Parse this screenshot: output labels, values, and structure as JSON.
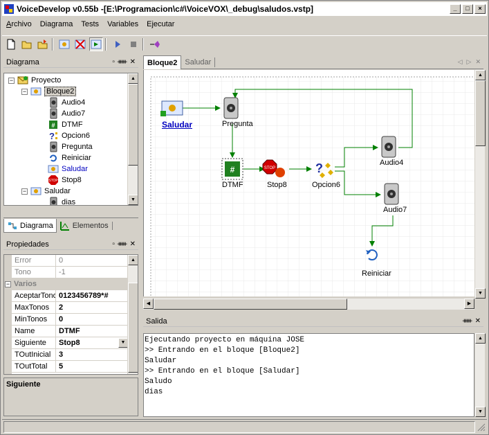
{
  "window": {
    "title": "VoiceDevelop v0.55b  -[E:\\Programacion\\c#\\VoiceVOX\\_debug\\saludos.vstp]",
    "controls": [
      "_",
      "□",
      "×"
    ]
  },
  "menu": [
    {
      "u": "A",
      "rest": "rchivo"
    },
    {
      "u": "",
      "rest": "Diagrama"
    },
    {
      "u": "",
      "rest": "Tests"
    },
    {
      "u": "",
      "rest": "Variables"
    },
    {
      "u": "",
      "rest": "Ejecutar"
    }
  ],
  "diagram_panel": {
    "title": "Diagrama",
    "tree": [
      {
        "label": "Proyecto",
        "icon": "envelope-icon",
        "expander": "−",
        "depth": 0
      },
      {
        "label": "Bloque2",
        "icon": "block-icon",
        "expander": "−",
        "depth": 1,
        "selected": true
      },
      {
        "label": "Audio4",
        "icon": "speaker-icon",
        "depth": 2
      },
      {
        "label": "Audio7",
        "icon": "speaker-icon",
        "depth": 2
      },
      {
        "label": "DTMF",
        "icon": "dtmf-icon",
        "depth": 2
      },
      {
        "label": "Opcion6",
        "icon": "question-icon",
        "depth": 2
      },
      {
        "label": "Pregunta",
        "icon": "speaker-icon",
        "depth": 2
      },
      {
        "label": "Reiniciar",
        "icon": "refresh-icon",
        "depth": 2
      },
      {
        "label": "Saludar",
        "icon": "block-icon",
        "depth": 2,
        "link": true
      },
      {
        "label": "Stop8",
        "icon": "stop-icon",
        "depth": 2
      },
      {
        "label": "Saludar",
        "icon": "block-icon",
        "expander": "−",
        "depth": 1
      },
      {
        "label": "dias",
        "icon": "speaker-icon",
        "depth": 2
      }
    ],
    "tabs": [
      "Diagrama",
      "Elementos"
    ]
  },
  "properties_panel": {
    "title": "Propiedades",
    "rows": [
      {
        "name": "Error",
        "value": "0",
        "disabled": true
      },
      {
        "name": "Tono",
        "value": "-1",
        "disabled": true
      },
      {
        "category": "Varios"
      },
      {
        "name": "AceptarTonos",
        "value": "0123456789*#"
      },
      {
        "name": "MaxTonos",
        "value": "2"
      },
      {
        "name": "MinTonos",
        "value": "0"
      },
      {
        "name": "Name",
        "value": "DTMF"
      },
      {
        "name": "Siguiente",
        "value": "Stop8",
        "dropdown": true
      },
      {
        "name": "TOutInicial",
        "value": "3"
      },
      {
        "name": "TOutTotal",
        "value": "5"
      }
    ],
    "description_title": "Siguiente"
  },
  "doc_tabs": [
    "Bloque2",
    "Saludar"
  ],
  "canvas": {
    "nodes": {
      "saludar": "Saludar",
      "pregunta": "Pregunta",
      "audio4": "Audio4",
      "dtmf": "DTMF",
      "stop8": "Stop8",
      "opcion6": "Opcion6",
      "audio7": "Audio7",
      "reiniciar": "Reiniciar"
    },
    "colors": {
      "link": "#0000c0",
      "arrow": "#008000",
      "grid": "#e4e4e4"
    }
  },
  "output_panel": {
    "title": "Salida",
    "lines": [
      "Ejecutando proyecto en máquina JOSE",
      ">> Entrando en el bloque [Bloque2]",
      "Saludar",
      ">> Entrando en el bloque [Saludar]",
      "Saludo",
      "dias"
    ]
  }
}
